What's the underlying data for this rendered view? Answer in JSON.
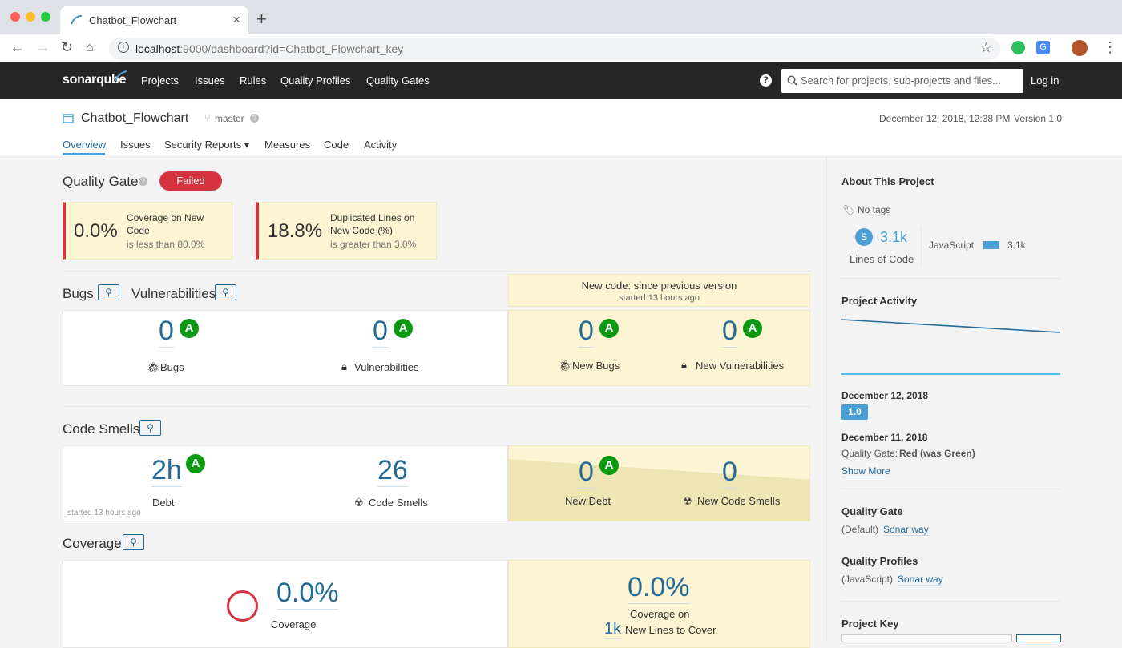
{
  "browser": {
    "tab_title": "Chatbot_Flowchart",
    "url_host": "localhost",
    "url_rest": ":9000/dashboard?id=Chatbot_Flowchart_key"
  },
  "nav": {
    "logo": "sonarqube",
    "links": [
      "Projects",
      "Issues",
      "Rules",
      "Quality Profiles",
      "Quality Gates"
    ],
    "help": "?",
    "search_placeholder": "Search for projects, sub-projects and files...",
    "login": "Log in"
  },
  "project": {
    "name": "Chatbot_Flowchart",
    "branch": "master",
    "analysis_date": "December 12, 2018, 12:38 PM",
    "version": "Version 1.0",
    "tabs": [
      "Overview",
      "Issues",
      "Security Reports ▾",
      "Measures",
      "Code",
      "Activity"
    ]
  },
  "quality_gate": {
    "title": "Quality Gate",
    "status": "Failed",
    "conditions": [
      {
        "value": "0.0%",
        "label": "Coverage on New Code",
        "threshold": "is less than 80.0%"
      },
      {
        "value": "18.8%",
        "label": "Duplicated Lines on New Code (%)",
        "threshold": "is greater than 3.0%"
      }
    ]
  },
  "new_code_period": {
    "title": "New code: since previous version",
    "subtitle": "started 13 hours ago"
  },
  "bugs_vulns": {
    "title_bugs": "Bugs",
    "title_vulns": "Vulnerabilities",
    "bugs": {
      "value": "0",
      "rating": "A",
      "label": "Bugs"
    },
    "vulns": {
      "value": "0",
      "rating": "A",
      "label": "Vulnerabilities"
    },
    "new_bugs": {
      "value": "0",
      "rating": "A",
      "label": "New Bugs"
    },
    "new_vulns": {
      "value": "0",
      "rating": "A",
      "label": "New Vulnerabilities"
    }
  },
  "code_smells": {
    "title": "Code Smells",
    "debt": {
      "value": "2h",
      "rating": "A",
      "label": "Debt",
      "note": "started 13 hours ago"
    },
    "smells": {
      "value": "26",
      "label": "Code Smells"
    },
    "new_debt": {
      "value": "0",
      "rating": "A",
      "label": "New Debt"
    },
    "new_smells": {
      "value": "0",
      "label": "New Code Smells"
    }
  },
  "coverage": {
    "title": "Coverage",
    "value": "0.0%",
    "label": "Coverage",
    "new_value": "0.0%",
    "new_label": "Coverage on",
    "new_lines_value": "1k",
    "new_lines_label": "New Lines to Cover"
  },
  "sidebar": {
    "about_title": "About This Project",
    "tags": "No tags",
    "loc_badge": "S",
    "loc_value": "3.1k",
    "loc_label": "Lines of Code",
    "lang_name": "JavaScript",
    "lang_value": "3.1k",
    "activity_title": "Project Activity",
    "events": [
      {
        "date": "December 12, 2018",
        "version": "1.0"
      },
      {
        "date": "December 11, 2018",
        "gate_label": "Quality Gate:",
        "gate_value": "Red (was Green)"
      }
    ],
    "show_more": "Show More",
    "qg_title": "Quality Gate",
    "qg_prefix": "(Default)",
    "qg_link": "Sonar way",
    "qp_title": "Quality Profiles",
    "qp_prefix": "(JavaScript)",
    "qp_link": "Sonar way",
    "key_title": "Project Key"
  },
  "colors": {
    "nav_bg": "#262626",
    "link_blue": "#236a97",
    "failed_red": "#d4333f",
    "rating_green": "#0a9a11",
    "new_code_yellow": "#fcf4d2"
  }
}
